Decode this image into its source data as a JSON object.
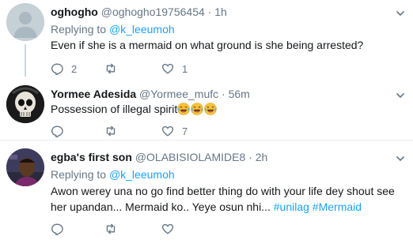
{
  "tweets": [
    {
      "name": "oghogho",
      "handle": "@oghogho19756454",
      "separator": "·",
      "time": "1h",
      "reply_prefix": "Replying to",
      "reply_to": "@k_leeumoh",
      "text": "Even if she is a mermaid on what ground is she being arrested?",
      "replies": "2",
      "retweets": "",
      "likes": "1"
    },
    {
      "name": "Yormee Adesida",
      "handle": "@Yormee_mufc",
      "separator": "·",
      "time": "56m",
      "text": "Possession of illegal spirit",
      "emoji": [
        "face-with-tears-of-joy",
        "face-with-tears-of-joy",
        "face-with-tears-of-joy"
      ],
      "replies": "",
      "retweets": "",
      "likes": "7"
    },
    {
      "name": "egba's first son",
      "handle": "@OLABISIOLAMIDE8",
      "separator": "·",
      "time": "2h",
      "reply_prefix": "Replying to",
      "reply_to": "@k_leeumoh",
      "text": "Awon werey una no go find better thing do with your life dey shout see her upandan... Mermaid ko.. Yeye osun nhi...",
      "hashtags": [
        "#unilag",
        "#Mermaid"
      ],
      "replies": "",
      "retweets": "",
      "likes": ""
    }
  ],
  "icons": {
    "reply": "reply-icon",
    "retweet": "retweet-icon",
    "like": "like-icon",
    "more": "chevron-down-icon"
  },
  "colors": {
    "link": "#1da1f2",
    "muted": "#657786",
    "text": "#14171a",
    "divider": "#e6ecf0",
    "thread_line": "#ccd6dd"
  }
}
